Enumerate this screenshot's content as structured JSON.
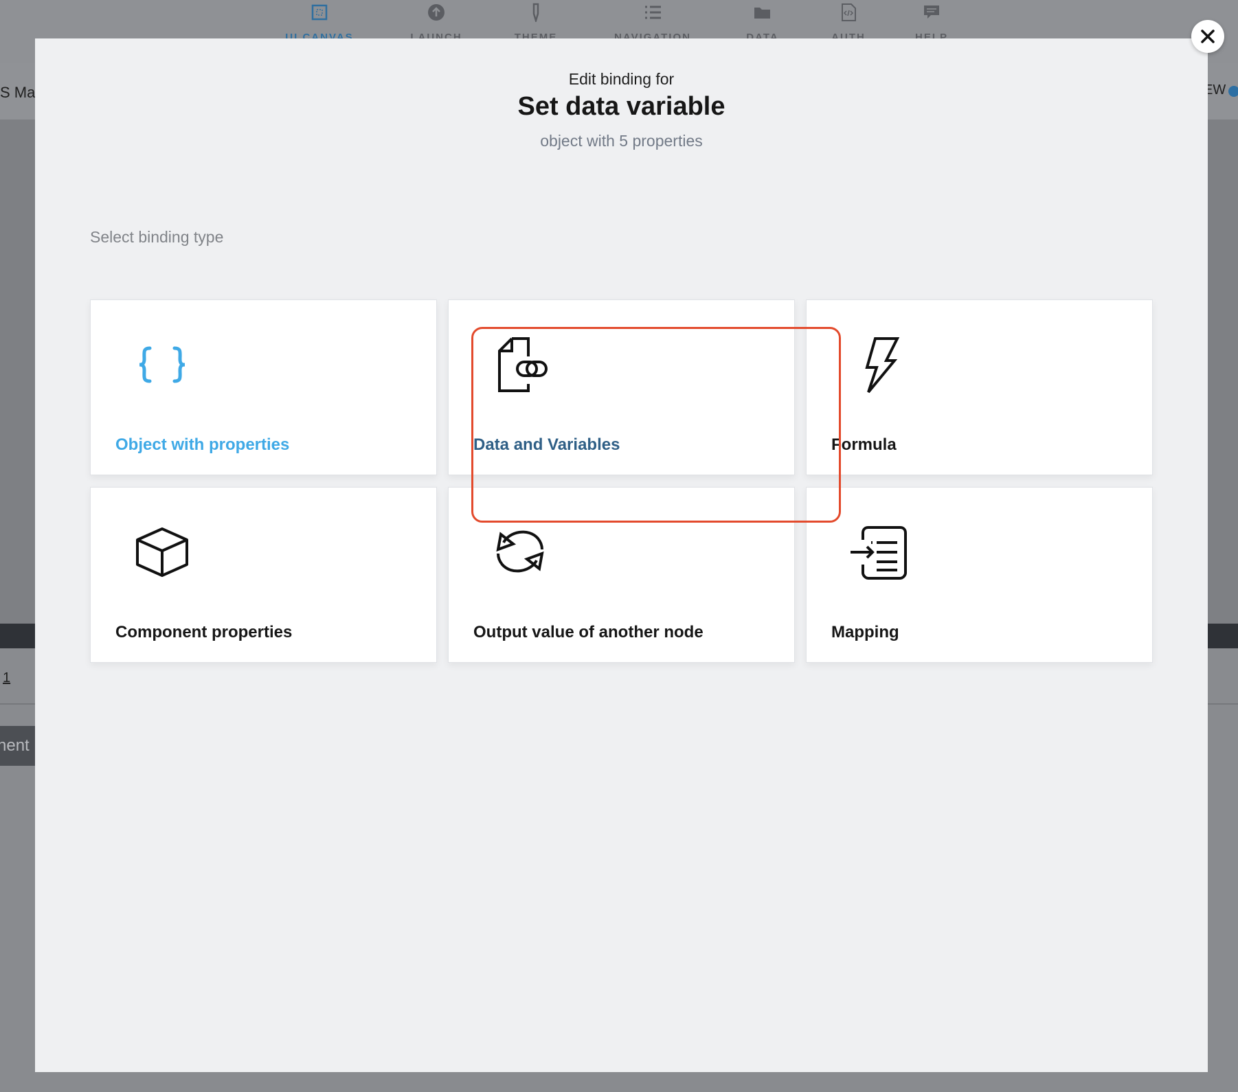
{
  "background": {
    "nav_items": [
      {
        "label": "UI CANVAS",
        "icon": "canvas-icon",
        "active": true
      },
      {
        "label": "LAUNCH",
        "icon": "upload-icon"
      },
      {
        "label": "THEME",
        "icon": "brush-icon"
      },
      {
        "label": "NAVIGATION",
        "icon": "list-icon"
      },
      {
        "label": "DATA",
        "icon": "folder-icon"
      },
      {
        "label": "AUTH",
        "icon": "code-file-icon"
      },
      {
        "label": "HELP",
        "icon": "chat-icon"
      }
    ],
    "left_text": "S Ma",
    "right_text": "EW",
    "link_text": "1",
    "button_text": "nent"
  },
  "modal": {
    "pretitle": "Edit binding for",
    "title": "Set data variable",
    "subtitle": "object with 5 properties",
    "section_label": "Select binding type",
    "cards": [
      {
        "label": "Object with properties",
        "icon": "curly-braces-icon",
        "color": "#3fa9e6"
      },
      {
        "label": "Data and Variables",
        "icon": "linked-document-icon",
        "color": "#2f5f86",
        "selected": true
      },
      {
        "label": "Formula",
        "icon": "lightning-icon",
        "color": "#161616"
      },
      {
        "label": "Component properties",
        "icon": "cube-icon",
        "color": "#161616"
      },
      {
        "label": "Output value of another node",
        "icon": "cycle-arrows-icon",
        "color": "#161616"
      },
      {
        "label": "Mapping",
        "icon": "mapping-list-icon",
        "color": "#161616"
      }
    ],
    "highlight_color": "#e34a2c",
    "close_icon": "close-icon"
  }
}
